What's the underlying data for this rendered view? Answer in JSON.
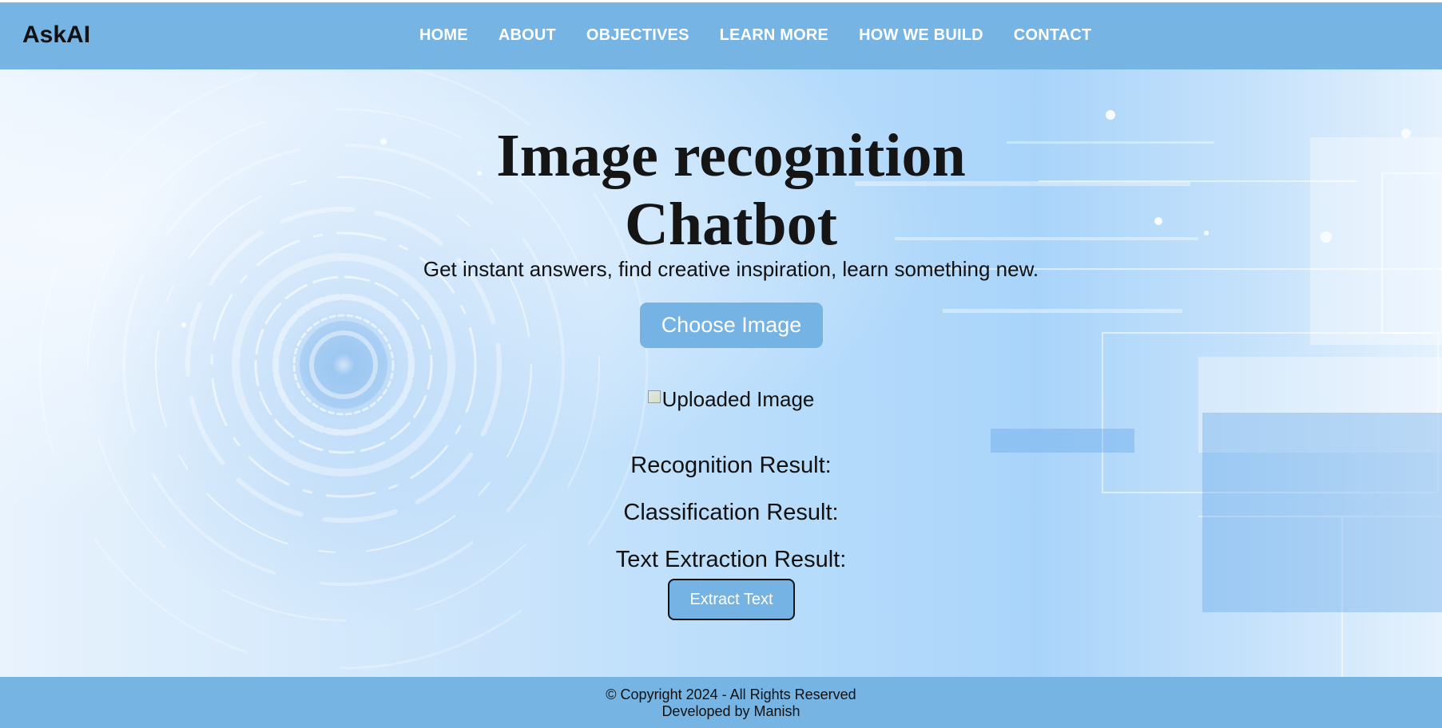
{
  "brand": "AskAI",
  "nav": [
    "HOME",
    "ABOUT",
    "OBJECTIVES",
    "LEARN MORE",
    "HOW WE BUILD",
    "CONTACT"
  ],
  "hero": {
    "title_line1": "Image recognition",
    "title_line2": "Chatbot",
    "subtitle": "Get instant answers, find creative inspiration, learn something new.",
    "choose_button": "Choose Image",
    "uploaded_alt": "Uploaded Image",
    "recognition_label": "Recognition Result:",
    "classification_label": "Classification Result:",
    "text_extraction_label": "Text Extraction Result:",
    "extract_button": "Extract Text"
  },
  "footer": {
    "copyright": "© Copyright 2024 - All Rights Reserved",
    "developer": "Developed by Manish"
  },
  "colors": {
    "nav_bg": "#75b4e3",
    "button_bg": "#74b3e4",
    "text": "#111111"
  }
}
